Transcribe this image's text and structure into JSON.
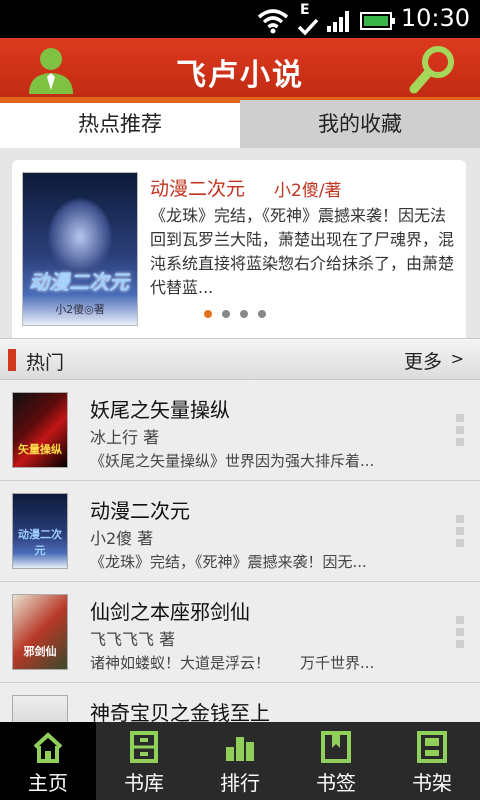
{
  "status_bar": {
    "time": "10:30",
    "network": "E"
  },
  "header": {
    "title": "飞卢小说",
    "user_icon": "user-icon",
    "search_icon": "search-icon"
  },
  "tabs": [
    {
      "label": "热点推荐",
      "active": true
    },
    {
      "label": "我的收藏",
      "active": false
    }
  ],
  "featured": {
    "title": "动漫二次元",
    "author": "小2傻/著",
    "description": "《龙珠》完结，《死神》震撼来袭！因无法回到瓦罗兰大陆，萧楚出现在了尸魂界，混沌系统直接将蓝染惣右介给抹杀了，由萧楚代替蓝...",
    "cover_title": "动漫二次元",
    "cover_author": "小2傻◎著",
    "pager": {
      "count": 4,
      "active_index": 0
    }
  },
  "section": {
    "title": "热门",
    "more_label": "更多",
    "more_arrow": ">"
  },
  "books": [
    {
      "name": "妖尾之矢量操纵",
      "author": "冰上行 著",
      "desc": "《妖尾之矢量操纵》世界因为强大排斥着...",
      "cover_label": "矢量操纵"
    },
    {
      "name": "动漫二次元",
      "author": "小2傻 著",
      "desc": "《龙珠》完结，《死神》震撼来袭！因无...",
      "cover_label": "动漫二次元"
    },
    {
      "name": "仙剑之本座邪剑仙",
      "author": "飞飞飞飞 著",
      "desc": "诸神如蝼蚁！大道是浮云！　　万千世界...",
      "cover_label": "邪剑仙"
    },
    {
      "name": "神奇宝贝之金钱至上",
      "author": "",
      "desc": "",
      "cover_label": ""
    }
  ],
  "bottom_nav": [
    {
      "label": "主页",
      "icon": "home-icon",
      "active": true
    },
    {
      "label": "书库",
      "icon": "library-icon",
      "active": false
    },
    {
      "label": "排行",
      "icon": "ranking-icon",
      "active": false
    },
    {
      "label": "书签",
      "icon": "bookmark-icon",
      "active": false
    },
    {
      "label": "书架",
      "icon": "bookshelf-icon",
      "active": false
    }
  ]
}
